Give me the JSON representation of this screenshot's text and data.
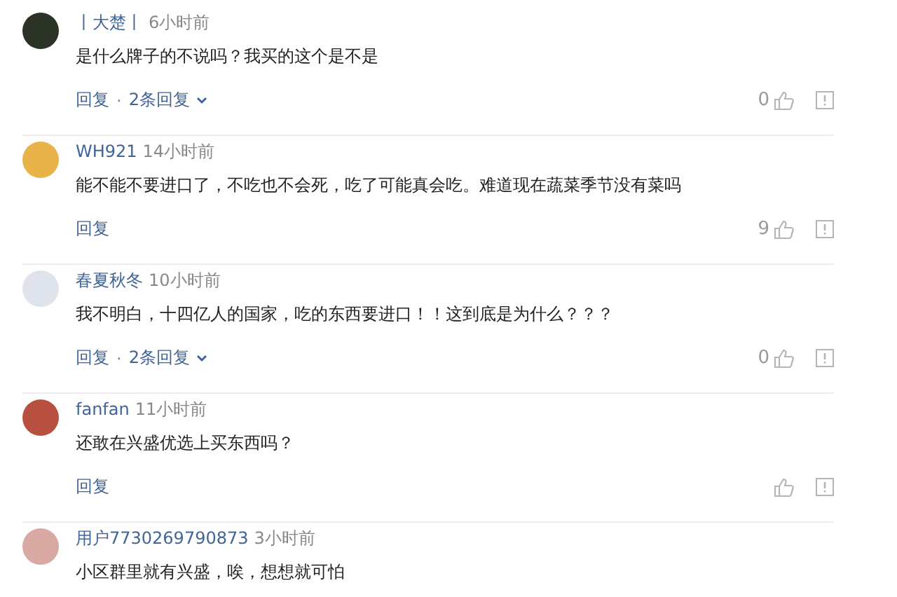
{
  "comments": [
    {
      "author": "丨大楚丨",
      "time": "6小时前",
      "text": "是什么牌子的不说吗？我买的这个是不是",
      "reply": "回复",
      "separator": "·",
      "replies": "2条回复",
      "likes": "0",
      "color": "#2a3326"
    },
    {
      "author": "WH921",
      "time": "14小时前",
      "text": "能不能不要进口了，不吃也不会死，吃了可能真会吃。难道现在蔬菜季节没有菜吗",
      "reply": "回复",
      "likes": "9",
      "color": "#e8b44a"
    },
    {
      "author": "春夏秋冬",
      "time": "10小时前",
      "text": "我不明白，十四亿人的国家，吃的东西要进口！！这到底是为什么？？？",
      "reply": "回复",
      "separator": "·",
      "replies": "2条回复",
      "likes": "0",
      "color": "#dfe4ec"
    },
    {
      "author": "fanfan",
      "time": "11小时前",
      "text": "还敢在兴盛优选上买东西吗？",
      "reply": "回复",
      "color": "#b8503f"
    },
    {
      "author": "用户7730269790873",
      "time": "3小时前",
      "text": "小区群里就有兴盛，唉，想想就可怕",
      "color": "#d9a9a3"
    }
  ]
}
